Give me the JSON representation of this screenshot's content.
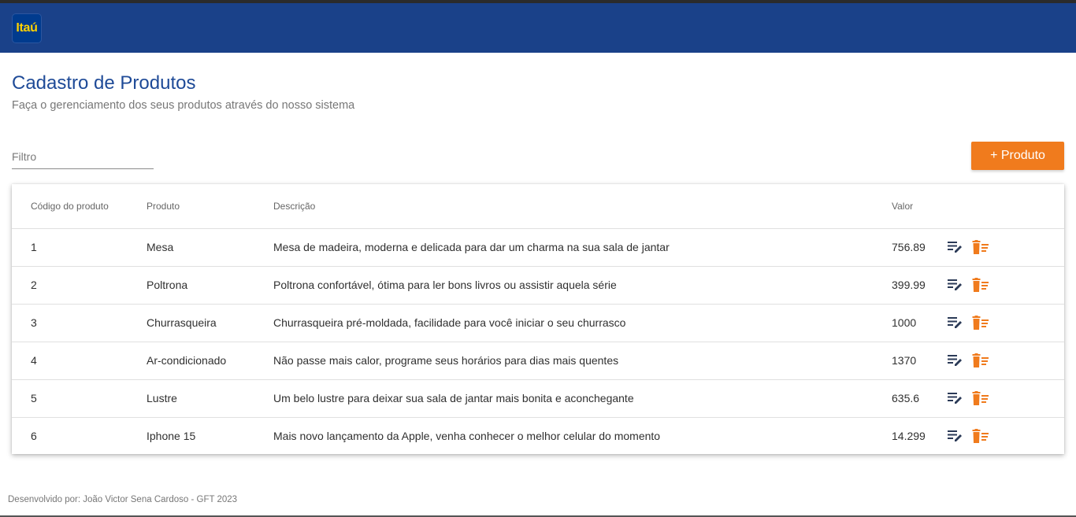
{
  "header": {
    "logo_text": "Itaú",
    "bg_color": "#1a4189",
    "logo_color": "#ffd200"
  },
  "page": {
    "title": "Cadastro de Produtos",
    "subtitle": "Faça o gerenciamento dos seus produtos através do nosso sistema"
  },
  "filter": {
    "placeholder": "Filtro",
    "value": ""
  },
  "add_button": {
    "label": "+ Produto",
    "color": "#f07b1d"
  },
  "table": {
    "columns": [
      "Código do produto",
      "Produto",
      "Descrição",
      "Valor"
    ],
    "rows": [
      {
        "code": "1",
        "name": "Mesa",
        "description": "Mesa de madeira, moderna e delicada para dar um charma na sua sala de jantar",
        "value": "756.89"
      },
      {
        "code": "2",
        "name": "Poltrona",
        "description": "Poltrona confortável, ótima para ler bons livros ou assistir aquela série",
        "value": "399.99"
      },
      {
        "code": "3",
        "name": "Churrasqueira",
        "description": "Churrasqueira pré-moldada, facilidade para você iniciar o seu churrasco",
        "value": "1000"
      },
      {
        "code": "4",
        "name": "Ar-condicionado",
        "description": "Não passe mais calor, programe seus horários para dias mais quentes",
        "value": "1370"
      },
      {
        "code": "5",
        "name": "Lustre",
        "description": "Um belo lustre para deixar sua sala de jantar mais bonita e aconchegante",
        "value": "635.6"
      },
      {
        "code": "6",
        "name": "Iphone 15",
        "description": "Mais novo lançamento da Apple, venha conhecer o melhor celular do momento",
        "value": "14.299"
      }
    ],
    "row_actions": {
      "edit_icon": "edit-list-icon",
      "delete_icon": "delete-list-icon",
      "edit_color": "#2b3a57",
      "delete_color": "#f07b1d"
    }
  },
  "footer": {
    "text": "Desenvolvido por: João Victor Sena Cardoso - GFT 2023"
  }
}
